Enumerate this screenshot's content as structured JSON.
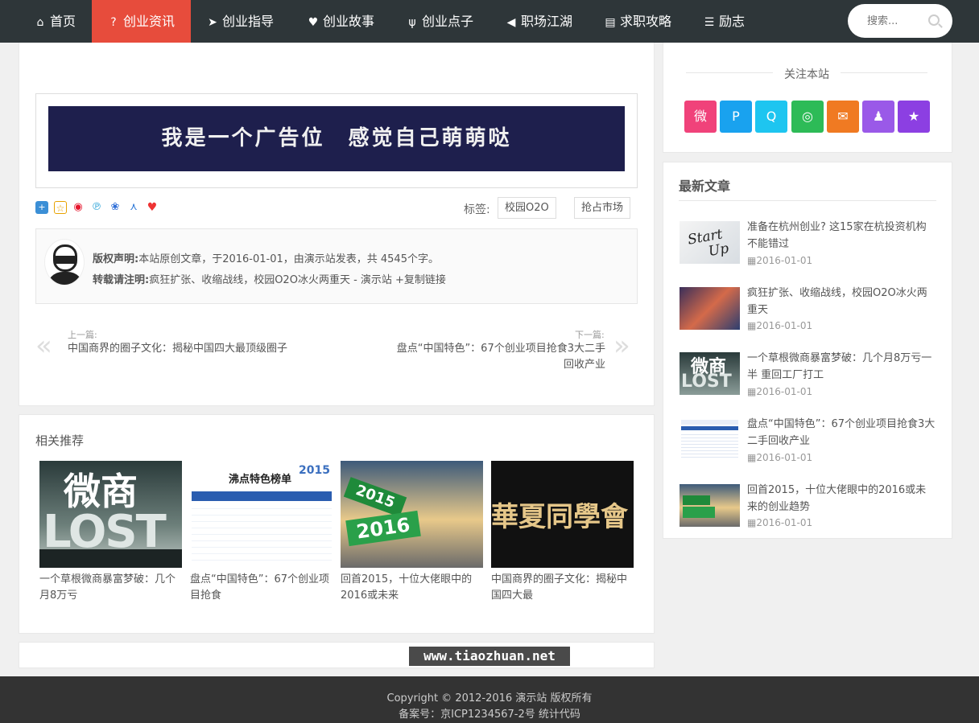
{
  "nav": {
    "items": [
      {
        "label": "首页",
        "icon": "home-icon",
        "glyph": "⌂"
      },
      {
        "label": "创业资讯",
        "icon": "question-circle-icon",
        "glyph": "?",
        "active": true
      },
      {
        "label": "创业指导",
        "icon": "paper-plane-icon",
        "glyph": "➤"
      },
      {
        "label": "创业故事",
        "icon": "heart-icon",
        "glyph": "♥"
      },
      {
        "label": "创业点子",
        "icon": "cutlery-icon",
        "glyph": "ψ"
      },
      {
        "label": "职场江湖",
        "icon": "bullhorn-icon",
        "glyph": "◀"
      },
      {
        "label": "求职攻略",
        "icon": "file-icon",
        "glyph": "▤"
      },
      {
        "label": "励志",
        "icon": "list-icon",
        "glyph": "☰"
      }
    ],
    "search_placeholder": "搜索...",
    "active_color": "#e74c3c",
    "bar_color": "#2e3639"
  },
  "ad": {
    "text": "我是一个广告位　感觉自己萌萌哒"
  },
  "tags": {
    "label": "标签:",
    "items": [
      "校园O2O",
      "抢占市场"
    ]
  },
  "copyright_box": {
    "line1_label": "版权声明:",
    "line1_text": "本站原创文章，于2016-01-01，由演示站发表，共 4545个字。",
    "line2_label": "转载请注明:",
    "line2_text": "疯狂扩张、收缩战线，校园O2O冰火两重天 - 演示站 +复制链接"
  },
  "post_nav": {
    "prev_label": "上一篇:",
    "prev_title": "中国商界的圈子文化：揭秘中国四大最顶级圈子",
    "next_label": "下一篇:",
    "next_title": "盘点“中国特色”：67个创业项目抢食3大二手回收产业"
  },
  "related": {
    "title": "相关推荐",
    "items": [
      {
        "caption": "一个草根微商暴富梦破：几个月8万亏",
        "thumb_text": "微商 LOST"
      },
      {
        "caption": "盘点“中国特色”：67个创业项目抢食",
        "thumb_text": "沸点特色榜单"
      },
      {
        "caption": "回首2015，十位大佬眼中的2016或未来",
        "thumb_text": "2015 2016"
      },
      {
        "caption": "中国商界的圈子文化：揭秘中国四大最",
        "thumb_text": "華夏同學會"
      }
    ]
  },
  "sidebar": {
    "follow_title": "关注本站",
    "follow_buttons": [
      {
        "icon": "weibo-icon",
        "glyph": "微",
        "color": "#f0427a"
      },
      {
        "icon": "tencent-weibo-icon",
        "glyph": "P",
        "color": "#19a2ef"
      },
      {
        "icon": "qq-icon",
        "glyph": "Q",
        "color": "#1ec5f0"
      },
      {
        "icon": "wechat-icon",
        "glyph": "◎",
        "color": "#2dbb57"
      },
      {
        "icon": "email-icon",
        "glyph": "✉",
        "color": "#f07a22"
      },
      {
        "icon": "group-icon",
        "glyph": "♟",
        "color": "#9a59e8"
      },
      {
        "icon": "star-icon",
        "glyph": "★",
        "color": "#8c3fe2"
      }
    ],
    "latest_title": "最新文章",
    "latest": [
      {
        "title": "准备在杭州创业? 这15家在杭投资机构不能错过",
        "date": "2016-01-01",
        "thumb_text": "Start Up"
      },
      {
        "title": "疯狂扩张、收缩战线，校园O2O冰火两重天",
        "date": "2016-01-01",
        "thumb_text": ""
      },
      {
        "title": "一个草根微商暴富梦破：几个月8万亏一半 重回工厂打工",
        "date": "2016-01-01",
        "thumb_text": "微商 LOST"
      },
      {
        "title": "盘点“中国特色”：67个创业项目抢食3大二手回收产业",
        "date": "2016-01-01",
        "thumb_text": "沸点特色榜单"
      },
      {
        "title": "回首2015，十位大佬眼中的2016或未来的创业趋势",
        "date": "2016-01-01",
        "thumb_text": "2015 2016"
      }
    ]
  },
  "watermark": "www.tiaozhuan.net",
  "footer": {
    "line1": "Copyright © 2012-2016 演示站 版权所有",
    "line2": "备案号：京ICP1234567-2号 统计代码"
  }
}
